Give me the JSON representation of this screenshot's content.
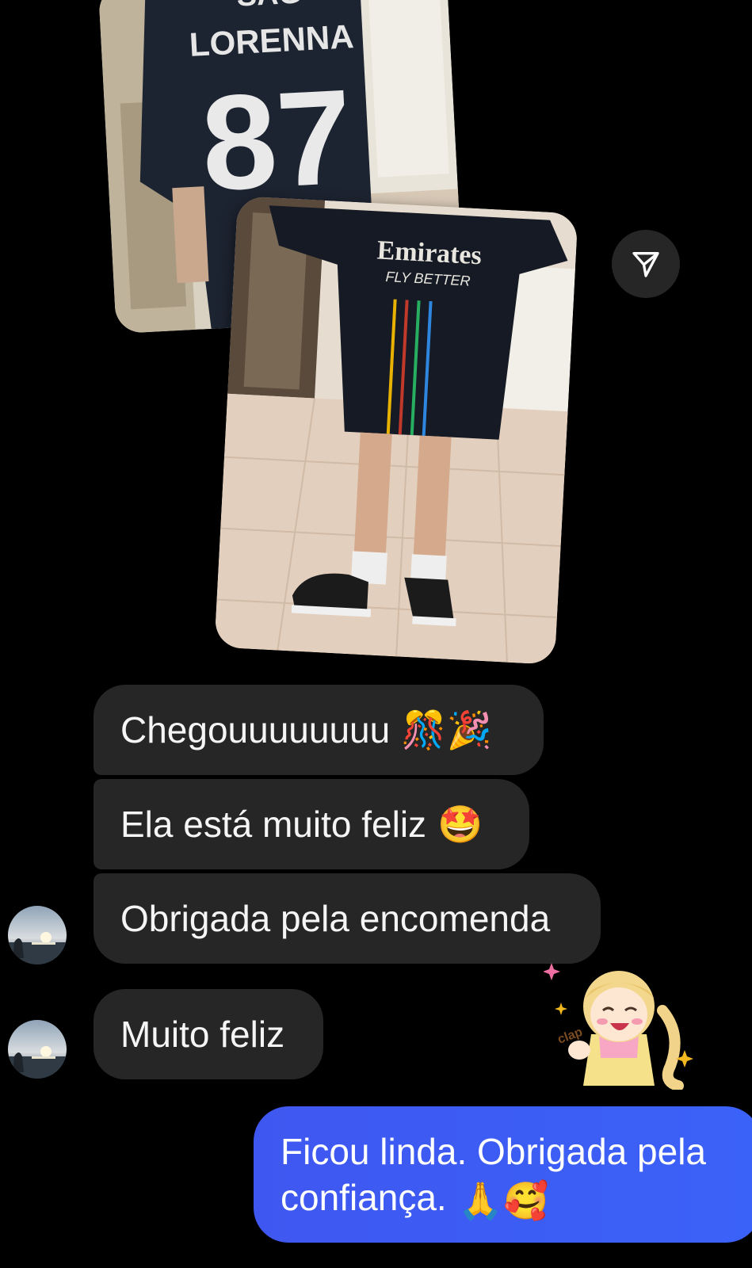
{
  "conversation": {
    "shared_media": [
      {
        "jersey_name": "LORENNA",
        "jersey_number": "87",
        "jersey_top": "SAG"
      },
      {
        "sponsor": "Emirates",
        "sponsor_tagline": "FLY BETTER"
      }
    ],
    "received_messages": [
      {
        "text": "Chegouuuuuuuu",
        "emoji": "🎊🎉"
      },
      {
        "text": "Ela está muito feliz",
        "emoji": "🤩"
      },
      {
        "text": "Obrigada pela encomenda",
        "emoji": ""
      },
      {
        "text": "Muito feliz",
        "emoji": ""
      }
    ],
    "sent_message": {
      "line1": "Ficou linda. Obrigada pela",
      "line2": "confiança.",
      "emoji": "🙏🥰"
    },
    "sticker": {
      "caption": "clap"
    }
  },
  "icons": {
    "share": "paper-plane-icon",
    "avatar": "contact-avatar"
  },
  "colors": {
    "background": "#000000",
    "received_bubble": "#262626",
    "sent_bubble": "#3d5afe",
    "text": "#f5f5f5"
  }
}
